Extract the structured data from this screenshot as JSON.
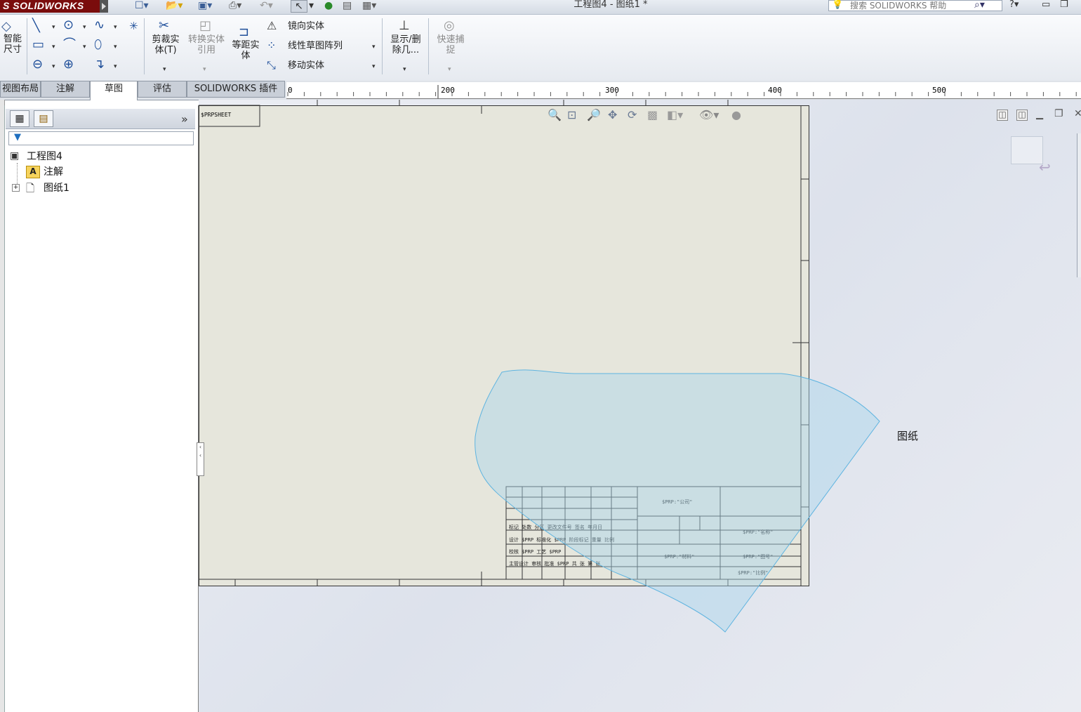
{
  "app": {
    "logo": "S SOLIDWORKS",
    "document_title": "工程图4 - 图纸1 *"
  },
  "search": {
    "placeholder": "搜索 SOLIDWORKS 帮助"
  },
  "ribbon": {
    "smart_dim": "智能尺寸",
    "trim": "剪裁实体(T)",
    "convert": "转换实体引用",
    "offset": "等距实体",
    "mirror": "镜向实体",
    "linear_pattern": "线性草图阵列",
    "move": "移动实体",
    "show_delete": "显示/删除几...",
    "quick_snap": "快速捕捉"
  },
  "tabs": [
    "视图布局",
    "注解",
    "草图",
    "评估",
    "SOLIDWORKS 插件"
  ],
  "ruler": {
    "labels": [
      "0",
      "200",
      "300",
      "400",
      "500"
    ]
  },
  "tree": {
    "root": "工程图4",
    "annotations": "注解",
    "sheet": "图纸1"
  },
  "canvas": {
    "sheet_name_label": "图纸",
    "corner_text": "$PRPSHEET"
  },
  "colors": {
    "accent": "#3a5e96",
    "logo_bg": "#7a0c0c",
    "selection": "#a8d4ea"
  }
}
